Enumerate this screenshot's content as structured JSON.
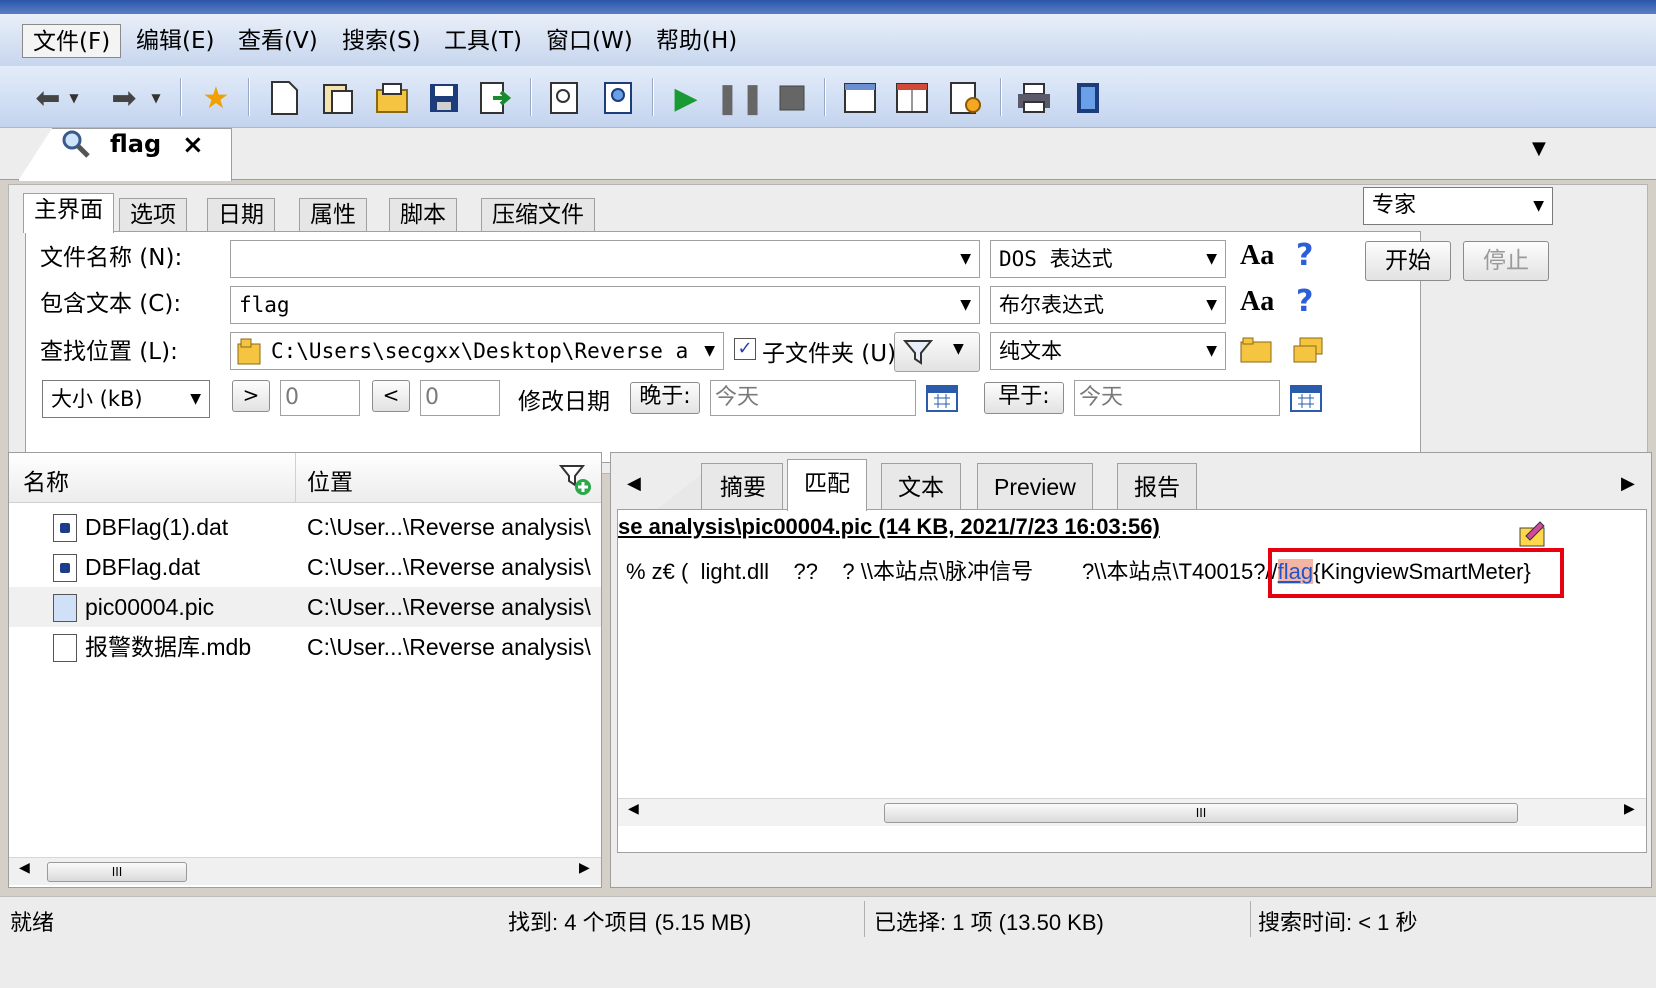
{
  "menu": {
    "items": [
      "文件(F)",
      "编辑(E)",
      "查看(V)",
      "搜索(S)",
      "工具(T)",
      "窗口(W)",
      "帮助(H)"
    ]
  },
  "search_tab": {
    "label": "flag",
    "close": "×"
  },
  "criteria_tabs": [
    "主界面",
    "选项",
    "日期",
    "属性",
    "脚本",
    "压缩文件"
  ],
  "mode": {
    "selected": "专家"
  },
  "buttons": {
    "start": "开始",
    "stop": "停止"
  },
  "filename": {
    "label": "文件名称 (N):",
    "value": "",
    "type": "DOS 表达式",
    "aa": "Aa",
    "help": "?"
  },
  "contains": {
    "label": "包含文本 (C):",
    "value": "flag",
    "type": "布尔表达式",
    "aa": "Aa",
    "help": "?"
  },
  "location": {
    "label": "查找位置 (L):",
    "value": "C:\\Users\\secgxx\\Desktop\\Reverse a",
    "subfolder": "子文件夹 (U)",
    "subfolder_checked": true,
    "type": "纯文本"
  },
  "size_row": {
    "size_select": "大小 (kB)",
    "gt_label": ">",
    "gt_value": "0",
    "lt_label": "<",
    "lt_value": "0",
    "date_label": "修改日期",
    "after_label": "晚于:",
    "after_value": "今天",
    "before_label": "早于:",
    "before_value": "今天"
  },
  "results": {
    "columns": {
      "name": "名称",
      "location": "位置"
    },
    "rows": [
      {
        "name": "DBFlag(1).dat",
        "path": "C:\\User...\\Reverse analysis\\"
      },
      {
        "name": "DBFlag.dat",
        "path": "C:\\User...\\Reverse analysis\\"
      },
      {
        "name": "pic00004.pic",
        "path": "C:\\User...\\Reverse analysis\\"
      },
      {
        "name": "报警数据库.mdb",
        "path": "C:\\User...\\Reverse analysis\\"
      }
    ],
    "scroll_thumb": "III"
  },
  "preview_tabs": [
    "摘要",
    "匹配",
    "文本",
    "Preview",
    "报告"
  ],
  "match": {
    "header": "se analysis\\pic00004.pic  (14 KB,  2021/7/23 16:03:56)",
    "line_prefix": "% z€ (  light.dll    ??    ? \\\\本站点\\脉冲信号        ?\\\\本站点\\T40015?//",
    "highlight": "flag",
    "line_suffix": "{KingviewSmartMeter}",
    "scroll_thumb": "III"
  },
  "status": {
    "ready": "就绪",
    "found": "找到: 4 个项目 (5.15 MB)",
    "selected": "已选择: 1 项 (13.50 KB)",
    "time": "搜索时间: < 1 秒"
  },
  "colors": {
    "highlight_box": "#e60012",
    "highlight_text": "#2255cc",
    "highlight_bg": "#f4b6a4"
  }
}
